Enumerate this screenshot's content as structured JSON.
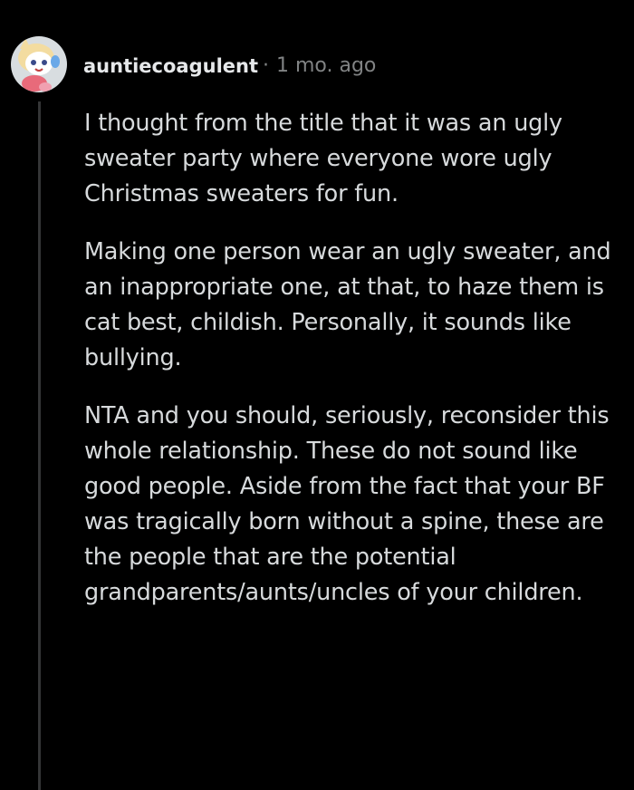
{
  "comment": {
    "username": "auntiecoagulent",
    "separator": "·",
    "timestamp": "1 mo. ago",
    "avatar_icon": "cartoon-character-avatar-icon",
    "paragraphs": [
      "I thought from the title that it was an ugly sweater party where everyone wore ugly Christmas sweaters for fun.",
      "Making one person wear an ugly sweater, and an inappropriate one, at that, to haze them is cat best, childish. Personally, it sounds like bullying.",
      "NTA and you should, seriously, reconsider this whole relationship. These do not sound like good people. Aside from the fact that your BF was tragically born without a spine, these are the people that are the potential grandparents/aunts/uncles of your children."
    ]
  },
  "colors": {
    "background": "#000000",
    "text": "#d7dadc",
    "username": "#e6e8ea",
    "meta": "#818384",
    "thread_line": "#343536"
  }
}
